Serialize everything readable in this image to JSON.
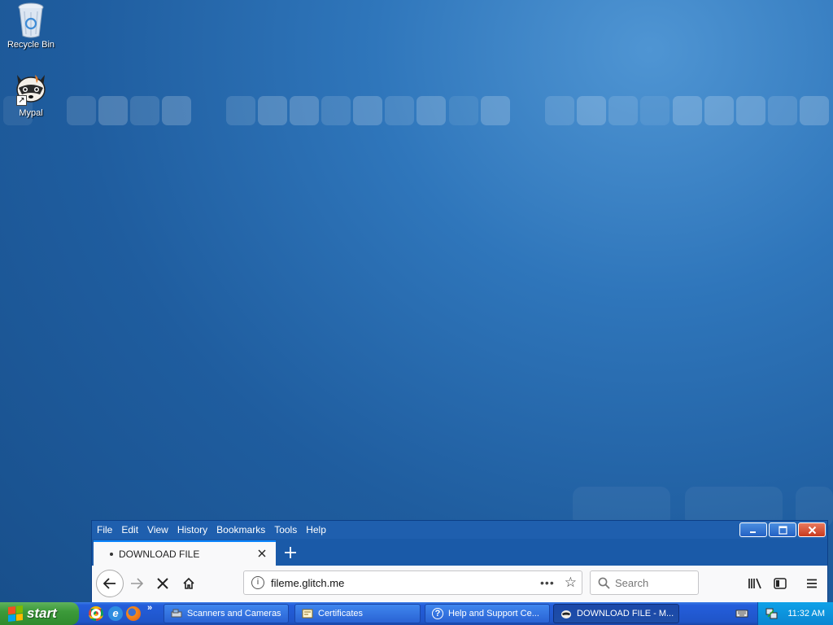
{
  "desktop": {
    "icons": [
      {
        "label": "Recycle Bin",
        "icon": "recycle-bin-icon"
      },
      {
        "label": "Mypal",
        "icon": "raccoon-icon"
      }
    ]
  },
  "browser": {
    "menu": [
      "File",
      "Edit",
      "View",
      "History",
      "Bookmarks",
      "Tools",
      "Help"
    ],
    "tab": {
      "title": "DOWNLOAD FILE"
    },
    "url": "fileme.glitch.me",
    "search_placeholder": "Search"
  },
  "taskbar": {
    "start_label": "start",
    "tasks": [
      {
        "label": "Scanners and Cameras",
        "icon": "scanner-icon"
      },
      {
        "label": "Certificates",
        "icon": "certificate-icon"
      },
      {
        "label": "Help and Support Ce...",
        "icon": "help-icon"
      },
      {
        "label": "DOWNLOAD FILE - M...",
        "icon": "mypal-icon",
        "active": true
      }
    ],
    "clock": "11:32 AM"
  },
  "colors": {
    "desktop_bg": "#2a6aae",
    "taskbar": "#245edb",
    "start_button": "#3c9a3a",
    "tray": "#0b86d2",
    "tab_accent": "#0a84ff"
  }
}
